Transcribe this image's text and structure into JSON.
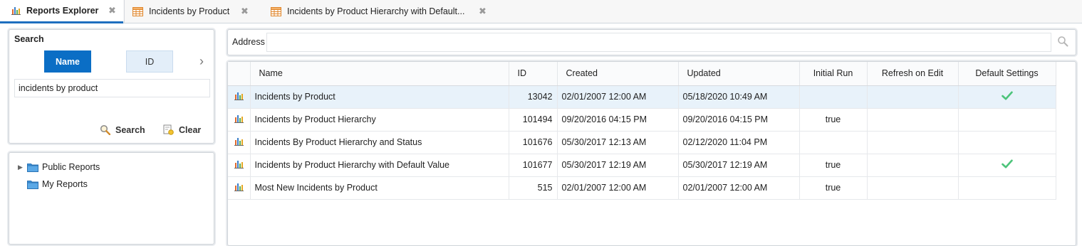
{
  "tabs": [
    {
      "label": "Reports Explorer",
      "icon": "report-chart-icon",
      "active": true
    },
    {
      "label": "Incidents by Product",
      "icon": "grid-table-icon",
      "active": false
    },
    {
      "label": "Incidents by Product Hierarchy with Default...",
      "icon": "grid-table-icon",
      "active": false
    }
  ],
  "tab_close_glyph": "✖",
  "search": {
    "title": "Search",
    "toggle_name": "Name",
    "toggle_id": "ID",
    "input_value": "incidents by product",
    "search_label": "Search",
    "clear_label": "Clear"
  },
  "tree": {
    "items": [
      {
        "label": "Public Reports",
        "expandable": true
      },
      {
        "label": "My Reports",
        "expandable": false
      }
    ]
  },
  "address": {
    "label": "Address",
    "value": ""
  },
  "grid": {
    "columns": [
      "Name",
      "ID",
      "Created",
      "Updated",
      "Initial Run",
      "Refresh on Edit",
      "Default Settings"
    ],
    "rows": [
      {
        "name": "Incidents by Product",
        "id": "13042",
        "created": "02/01/2007 12:00 AM",
        "updated": "05/18/2020 10:49 AM",
        "initial_run": "",
        "refresh_on_edit": "",
        "default_settings": true,
        "selected": true
      },
      {
        "name": "Incidents by Product Hierarchy",
        "id": "101494",
        "created": "09/20/2016 04:15 PM",
        "updated": "09/20/2016 04:15 PM",
        "initial_run": "true",
        "refresh_on_edit": "",
        "default_settings": false,
        "selected": false
      },
      {
        "name": "Incidents By Product Hierarchy and Status",
        "id": "101676",
        "created": "05/30/2017 12:13 AM",
        "updated": "02/12/2020 11:04 PM",
        "initial_run": "",
        "refresh_on_edit": "",
        "default_settings": false,
        "selected": false
      },
      {
        "name": "Incidents by Product Hierarchy with Default Value",
        "id": "101677",
        "created": "05/30/2017 12:19 AM",
        "updated": "05/30/2017 12:19 AM",
        "initial_run": "true",
        "refresh_on_edit": "",
        "default_settings": true,
        "selected": false
      },
      {
        "name": "Most New Incidents by Product",
        "id": "515",
        "created": "02/01/2007 12:00 AM",
        "updated": "02/01/2007 12:00 AM",
        "initial_run": "true",
        "refresh_on_edit": "",
        "default_settings": false,
        "selected": false
      }
    ]
  },
  "colors": {
    "accent": "#0b6ec5",
    "selected_row": "#e8f2fa",
    "check": "#4cc47a",
    "folder": "#3d93d9"
  }
}
